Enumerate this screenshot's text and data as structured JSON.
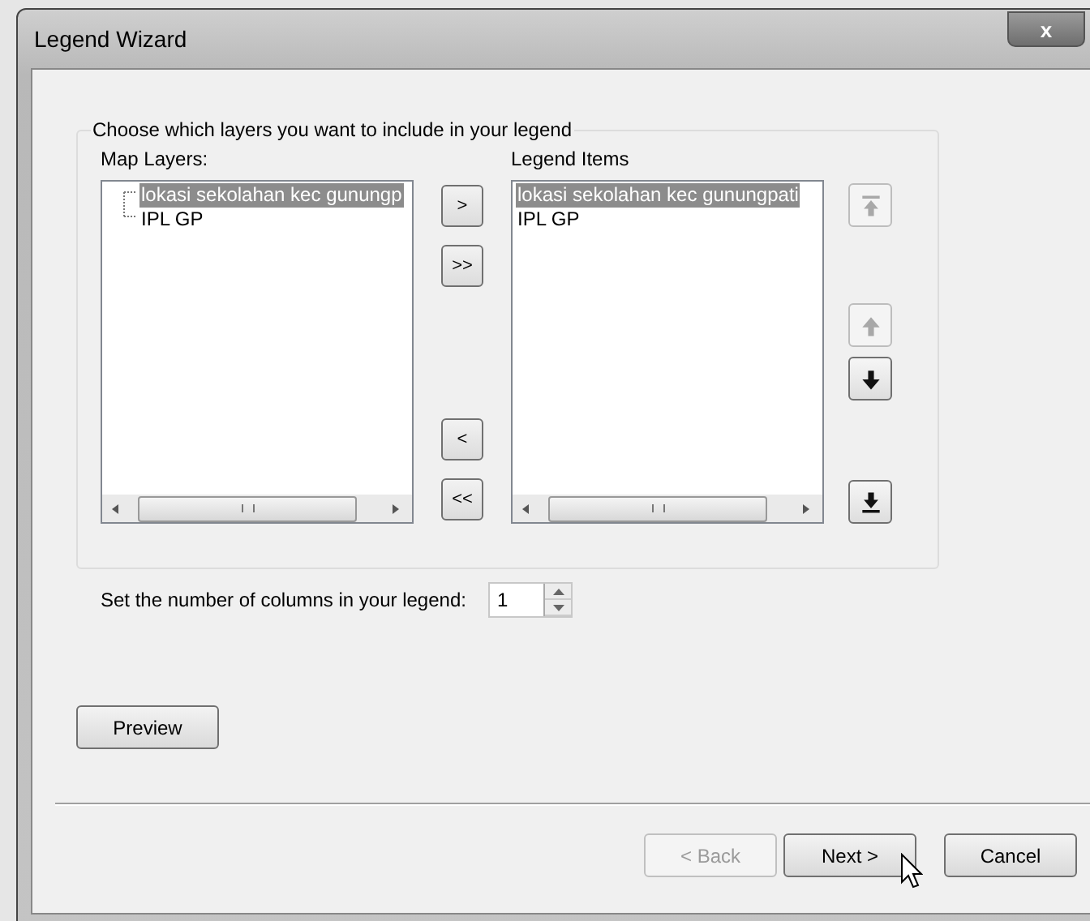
{
  "window": {
    "title": "Legend Wizard",
    "close": "x"
  },
  "group": {
    "title": "Choose which layers you want to include in your legend",
    "map_layers": {
      "label": "Map Layers:",
      "items": [
        {
          "label": "lokasi sekolahan kec gunungp",
          "selected": true
        },
        {
          "label": "IPL GP",
          "selected": false
        }
      ]
    },
    "transfer_buttons": [
      {
        "label": ">"
      },
      {
        "label": ">>"
      },
      {
        "label": "<"
      },
      {
        "label": "<<"
      }
    ],
    "legend_items": {
      "label": "Legend Items",
      "items": [
        {
          "label": "lokasi sekolahan kec gunungpati",
          "selected": true
        },
        {
          "label": "IPL GP",
          "selected": false
        }
      ]
    },
    "order_buttons": [
      {
        "kind": "top",
        "disabled": true
      },
      {
        "kind": "up",
        "disabled": true
      },
      {
        "kind": "down",
        "disabled": false
      },
      {
        "kind": "bottom",
        "disabled": false
      }
    ]
  },
  "columns": {
    "label": "Set the number of columns in your legend:",
    "value": "1"
  },
  "preview_button": "Preview",
  "nav_buttons": [
    {
      "label": "< Back",
      "disabled": true
    },
    {
      "label": "Next >",
      "disabled": false
    },
    {
      "label": "Cancel",
      "disabled": false
    }
  ]
}
